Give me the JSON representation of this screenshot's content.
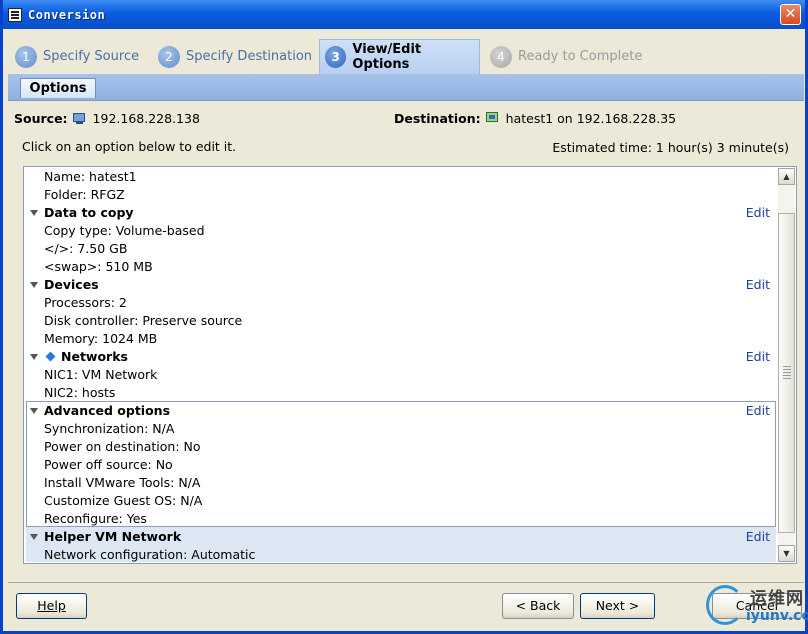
{
  "window": {
    "title": "Conversion",
    "close_glyph": "✕"
  },
  "steps": [
    {
      "num": "1",
      "label": "Specify Source",
      "state": "done"
    },
    {
      "num": "2",
      "label": "Specify Destination",
      "state": "done"
    },
    {
      "num": "3",
      "label": "View/Edit Options",
      "state": "active"
    },
    {
      "num": "4",
      "label": "Ready to Complete",
      "state": "disabled"
    }
  ],
  "subtab": {
    "label": "Options"
  },
  "source": {
    "label": "Source:",
    "value": "192.168.228.138",
    "icon": "monitor-icon"
  },
  "destination": {
    "label": "Destination:",
    "value": "hatest1 on 192.168.228.35",
    "icon": "vm-icon"
  },
  "hint": "Click on an option below to edit it.",
  "estimate": "Estimated time: 1 hour(s) 3 minute(s)",
  "options": {
    "name": "Name: hatest1",
    "folder": "Folder: RFGZ",
    "edit_label": "Edit",
    "data_to_copy": {
      "title": "Data to copy",
      "items": [
        "Copy type: Volume-based",
        "</>: 7.50 GB",
        "<swap>: 510 MB"
      ]
    },
    "devices": {
      "title": "Devices",
      "items": [
        "Processors: 2",
        "Disk controller: Preserve source",
        "Memory: 1024 MB"
      ]
    },
    "networks": {
      "title": "Networks",
      "items": [
        "NIC1: VM Network",
        "NIC2: hosts"
      ]
    },
    "advanced": {
      "title": "Advanced options",
      "items": [
        "Synchronization: N/A",
        "Power on destination: No",
        "Power off source: No",
        "Install VMware Tools: N/A",
        "Customize Guest OS: N/A",
        "Reconfigure: Yes"
      ]
    },
    "helper": {
      "title": "Helper VM Network",
      "items": [
        "Network configuration: Automatic"
      ]
    }
  },
  "buttons": {
    "help": "Help",
    "back": "< Back",
    "next": "Next >",
    "cancel": "Cancel"
  },
  "watermark": {
    "top": "运维网",
    "bottom": "iyunv.com"
  }
}
